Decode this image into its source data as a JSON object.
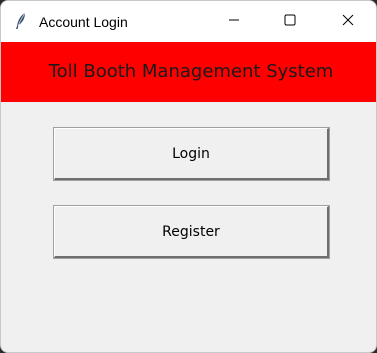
{
  "window": {
    "title": "Account Login",
    "icon": "feather-icon"
  },
  "controls": {
    "minimize_icon": "minimize-icon",
    "maximize_icon": "maximize-icon",
    "close_icon": "close-icon"
  },
  "header": {
    "title": "Toll Booth Management System",
    "background": "#ff0000"
  },
  "buttons": {
    "login_label": "Login",
    "register_label": "Register"
  }
}
